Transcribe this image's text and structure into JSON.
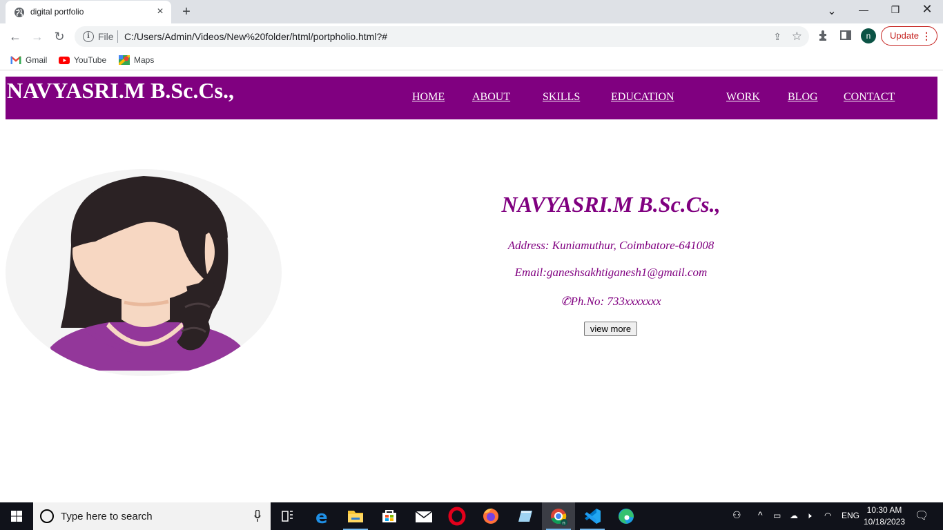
{
  "browser": {
    "tab_title": "digital portfolio",
    "new_tab": "+",
    "url_scheme": "File",
    "url": "C:/Users/Admin/Videos/New%20folder/html/portpholio.html?#",
    "profile_initial": "n",
    "update_label": "Update",
    "bookmarks": [
      {
        "label": "Gmail",
        "icon": "gmail-icon"
      },
      {
        "label": "YouTube",
        "icon": "youtube-icon"
      },
      {
        "label": "Maps",
        "icon": "maps-icon"
      }
    ]
  },
  "page": {
    "brand": "NAVYASRI.M B.Sc.Cs.,",
    "nav": [
      "HOME",
      "ABOUT",
      "SKILLS",
      "EDUCATION",
      "WORK",
      "BLOG",
      "CONTACT"
    ],
    "profile": {
      "name": "NAVYASRI.M B.Sc.Cs.,",
      "address": "Address: Kuniamuthur, Coimbatore-641008",
      "email": "Email:ganeshsakhtiganesh1@gmail.com",
      "phone": "✆Ph.No: 733xxxxxxx",
      "button": "view more"
    },
    "colors": {
      "accent": "#800080",
      "text_on_accent": "#ffffff"
    }
  },
  "taskbar": {
    "search_placeholder": "Type here to search",
    "apps": [
      "task-view",
      "edge-legacy",
      "file-explorer",
      "microsoft-store",
      "mail",
      "opera",
      "firefox",
      "notepad",
      "chrome",
      "vs-code",
      "edge"
    ],
    "active_app": "chrome",
    "language": "ENG",
    "time": "10:30 AM",
    "date": "10/18/2023"
  }
}
